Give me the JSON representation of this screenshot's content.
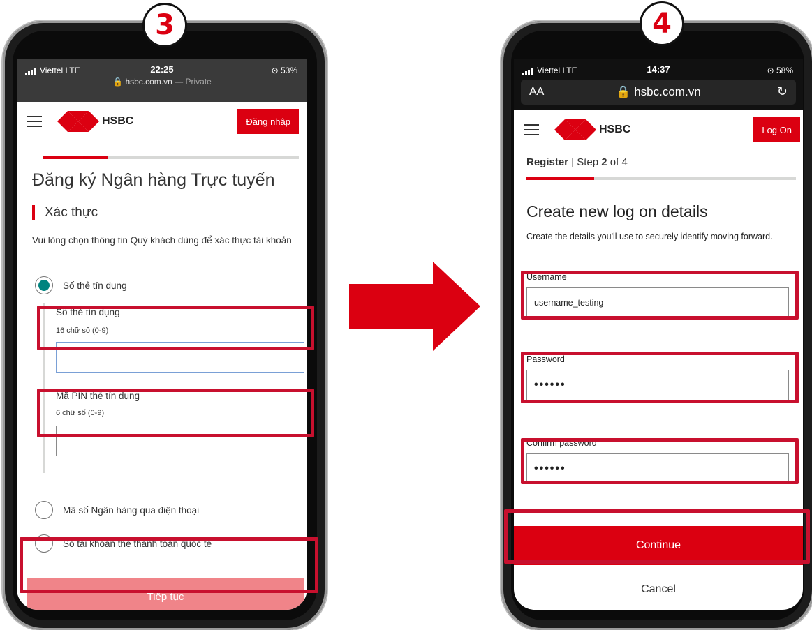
{
  "steps": [
    {
      "badge": "3",
      "status": {
        "carrier": "Viettel  LTE",
        "time": "22:25",
        "battery": "⊙ 53%",
        "url": "🔒 hsbc.com.vn",
        "private": " — Private"
      },
      "header": {
        "brand": "HSBC",
        "login_label": "Đăng nhập"
      },
      "progress": 0.25,
      "title": "Đăng ký Ngân hàng Trực tuyến",
      "section": "Xác thực",
      "description": "Vui lòng chọn thông tin Quý khách dùng để xác thực tài khoản",
      "options": [
        {
          "label": "Số thẻ tín dụng",
          "selected": true
        },
        {
          "label": "Mã số Ngân hàng qua điện thoại",
          "selected": false
        },
        {
          "label": "Số tài khoản thẻ thanh toán quốc tế",
          "selected": false
        }
      ],
      "fields": [
        {
          "label": "Số thẻ tín dụng",
          "hint": "16 chữ số (0-9)",
          "value": ""
        },
        {
          "label": "Mã PIN thẻ tín dụng",
          "hint": "6 chữ số (0-9)",
          "value": ""
        }
      ],
      "button": "Tiếp tục"
    },
    {
      "badge": "4",
      "status": {
        "carrier": "Viettel  LTE",
        "time": "14:37",
        "battery": "⊙ 58%",
        "aa": "AA",
        "url": "🔒 hsbc.com.vn",
        "reload": "↻"
      },
      "header": {
        "brand": "HSBC",
        "login_label": "Log On"
      },
      "progress": 0.25,
      "step_prefix": "Register",
      "step_mid": " | Step ",
      "step_num": "2",
      "step_suffix": " of 4",
      "title": "Create new log on details",
      "description": "Create the details you'll use to securely identify moving forward.",
      "fields": [
        {
          "label": "Username",
          "value": "username_testing"
        },
        {
          "label": "Password",
          "value": "••••••"
        },
        {
          "label": "Confirm password",
          "value": "••••••"
        }
      ],
      "button": "Continue",
      "cancel": "Cancel"
    }
  ],
  "colors": {
    "brand_red": "#db0011",
    "highlight": "#c8102e",
    "radio_selected": "#00847f",
    "disabled_button": "#f08489"
  }
}
